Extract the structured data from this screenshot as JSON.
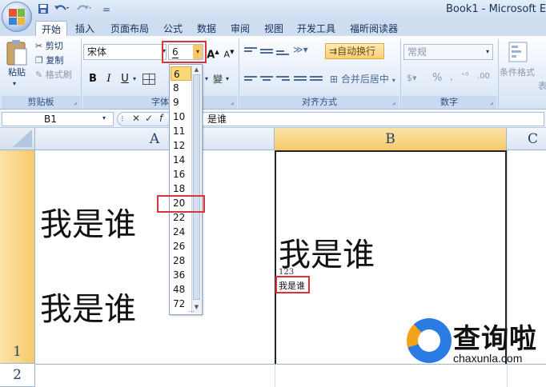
{
  "window": {
    "title": "Book1 - Microsoft Exce"
  },
  "quick_access": {
    "save_icon": "save-icon",
    "undo_icon": "undo-icon",
    "redo_icon": "redo-icon",
    "customize": "="
  },
  "tabs": [
    {
      "label": "开始",
      "active": true
    },
    {
      "label": "插入"
    },
    {
      "label": "页面布局"
    },
    {
      "label": "公式"
    },
    {
      "label": "数据"
    },
    {
      "label": "审阅"
    },
    {
      "label": "视图"
    },
    {
      "label": "开发工具"
    },
    {
      "label": "福昕阅读器"
    }
  ],
  "clipboard": {
    "paste": "粘贴",
    "cut": "剪切",
    "copy": "复制",
    "format_painter": "格式刷",
    "group": "剪贴板"
  },
  "font": {
    "name": "宋体",
    "size": "6",
    "group": "字体",
    "bold": "B",
    "italic": "I",
    "underline": "U",
    "grow": "A",
    "shrink": "A"
  },
  "alignment": {
    "wrap_text": "自动换行",
    "merge_center": "合并后居中",
    "group": "对齐方式"
  },
  "number": {
    "format": "常规",
    "percent": "%",
    "group": "数字"
  },
  "styles": {
    "conditional": "条件格式",
    "table_partial": "表"
  },
  "formula_bar": {
    "name_box": "B1",
    "content": "我是谁",
    "content_partial": "是谁"
  },
  "font_size_list": [
    "6",
    "8",
    "9",
    "10",
    "11",
    "12",
    "14",
    "16",
    "18",
    "20",
    "22",
    "24",
    "26",
    "28",
    "36",
    "48",
    "72"
  ],
  "font_size_selected": "6",
  "font_size_highlighted": "20",
  "columns": [
    {
      "label": "A"
    },
    {
      "label": "B",
      "selected": true
    },
    {
      "label": "C"
    }
  ],
  "rows": [
    {
      "label": "1",
      "selected": true
    },
    {
      "label": "2"
    }
  ],
  "cells": {
    "A1_line1": "我是谁",
    "A1_line2": "我是谁",
    "B1_big": "我是谁",
    "B1_num": "123",
    "B1_small": "我是谁"
  },
  "watermark": {
    "name": "查询啦",
    "url": "chaxunla.com"
  },
  "colors": {
    "accent_red": "#d9343a",
    "selection_orange": "#f7c96a",
    "highlight_yellow": "#fbd979"
  }
}
